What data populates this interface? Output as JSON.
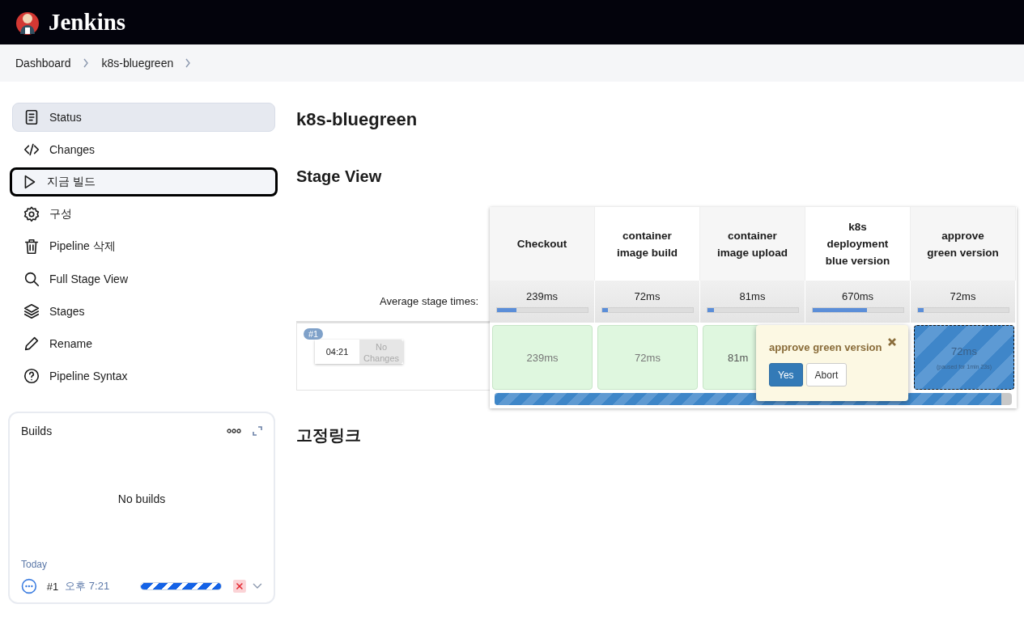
{
  "header": {
    "brand": "Jenkins"
  },
  "breadcrumb": [
    "Dashboard",
    "k8s-bluegreen"
  ],
  "sidebar": {
    "items": [
      {
        "label": "Status",
        "kind": "document",
        "selected": true,
        "focused": false
      },
      {
        "label": "Changes",
        "kind": "code",
        "selected": false,
        "focused": false
      },
      {
        "label": "지금 빌드",
        "kind": "play",
        "selected": false,
        "focused": true
      },
      {
        "label": "구성",
        "kind": "gear",
        "selected": false,
        "focused": false
      },
      {
        "label": "Pipeline 삭제",
        "kind": "trash",
        "selected": false,
        "focused": false
      },
      {
        "label": "Full Stage View",
        "kind": "search",
        "selected": false,
        "focused": false
      },
      {
        "label": "Stages",
        "kind": "layers",
        "selected": false,
        "focused": false
      },
      {
        "label": "Rename",
        "kind": "pencil",
        "selected": false,
        "focused": false
      },
      {
        "label": "Pipeline Syntax",
        "kind": "help",
        "selected": false,
        "focused": false
      }
    ]
  },
  "builds": {
    "title": "Builds",
    "empty": "No builds",
    "group": "Today",
    "rows": [
      {
        "number": "#1",
        "time": "오후 7:21",
        "kind": "running",
        "level": 1
      }
    ]
  },
  "page_title": "k8s-bluegreen",
  "stage_view": {
    "title": "Stage View",
    "avg_label": "Average stage times:",
    "stages": [
      {
        "name": "Checkout",
        "avg": "239ms",
        "level": 0.22
      },
      {
        "name": "container image build",
        "avg": "72ms",
        "level": 0.07
      },
      {
        "name": "container image upload",
        "avg": "81ms",
        "level": 0.08
      },
      {
        "name": "k8s deployment blue version",
        "avg": "670ms",
        "level": 0.6
      },
      {
        "name": "approve green version",
        "avg": "72ms",
        "level": 0.07
      }
    ],
    "run": {
      "badge": "#1",
      "time": "04:21",
      "changes": "No Changes",
      "progress": {
        "level": 0.98
      },
      "cells": [
        {
          "kind": "success",
          "duration": "239ms"
        },
        {
          "kind": "success",
          "duration": "72ms"
        },
        {
          "kind": "success",
          "duration": "81m"
        },
        {
          "kind": "paused",
          "duration": "72ms",
          "note": "(paused for 1min 23s)"
        }
      ]
    },
    "prompt": {
      "message": "approve green version",
      "buttons": [
        "Yes",
        "Abort"
      ]
    }
  },
  "permalinks_title": "고정링크"
}
